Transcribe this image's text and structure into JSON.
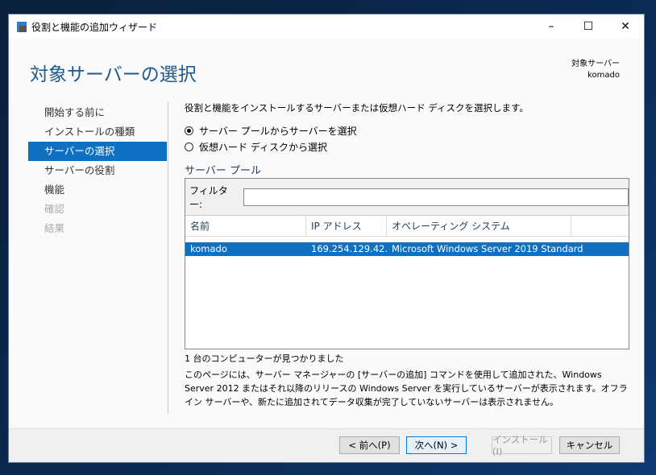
{
  "window": {
    "title": "役割と機能の追加ウィザード",
    "minimize": "–",
    "maximize": "☐",
    "close": "✕"
  },
  "header": {
    "title": "対象サーバーの選択",
    "target_label": "対象サーバー",
    "target_value": "komado"
  },
  "nav": [
    "開始する前に",
    "インストールの種類",
    "サーバーの選択",
    "サーバーの役割",
    "機能",
    "確認",
    "結果"
  ],
  "main": {
    "description": "役割と機能をインストールするサーバーまたは仮想ハード ディスクを選択します。",
    "radio1": "サーバー プールからサーバーを選択",
    "radio2": "仮想ハード ディスクから選択",
    "pool_title": "サーバー プール",
    "filter_label": "フィルター:",
    "filter_value": "",
    "columns": [
      "名前",
      "IP アドレス",
      "オペレーティング システム"
    ],
    "rows": [
      {
        "name": "komado",
        "ip": "169.254.129.42...",
        "os": "Microsoft Windows Server 2019 Standard"
      }
    ],
    "found": "1 台のコンピューターが見つかりました",
    "info": "このページには、サーバー マネージャーの [サーバーの追加] コマンドを使用して追加された、Windows Server 2012 またはそれ以降のリリースの Windows Server を実行しているサーバーが表示されます。オフライン サーバーや、新たに追加されてデータ収集が完了していないサーバーは表示されません。"
  },
  "buttons": {
    "prev": "< 前へ(P)",
    "next": "次へ(N) >",
    "install": "インストール(I)",
    "cancel": "キャンセル"
  }
}
